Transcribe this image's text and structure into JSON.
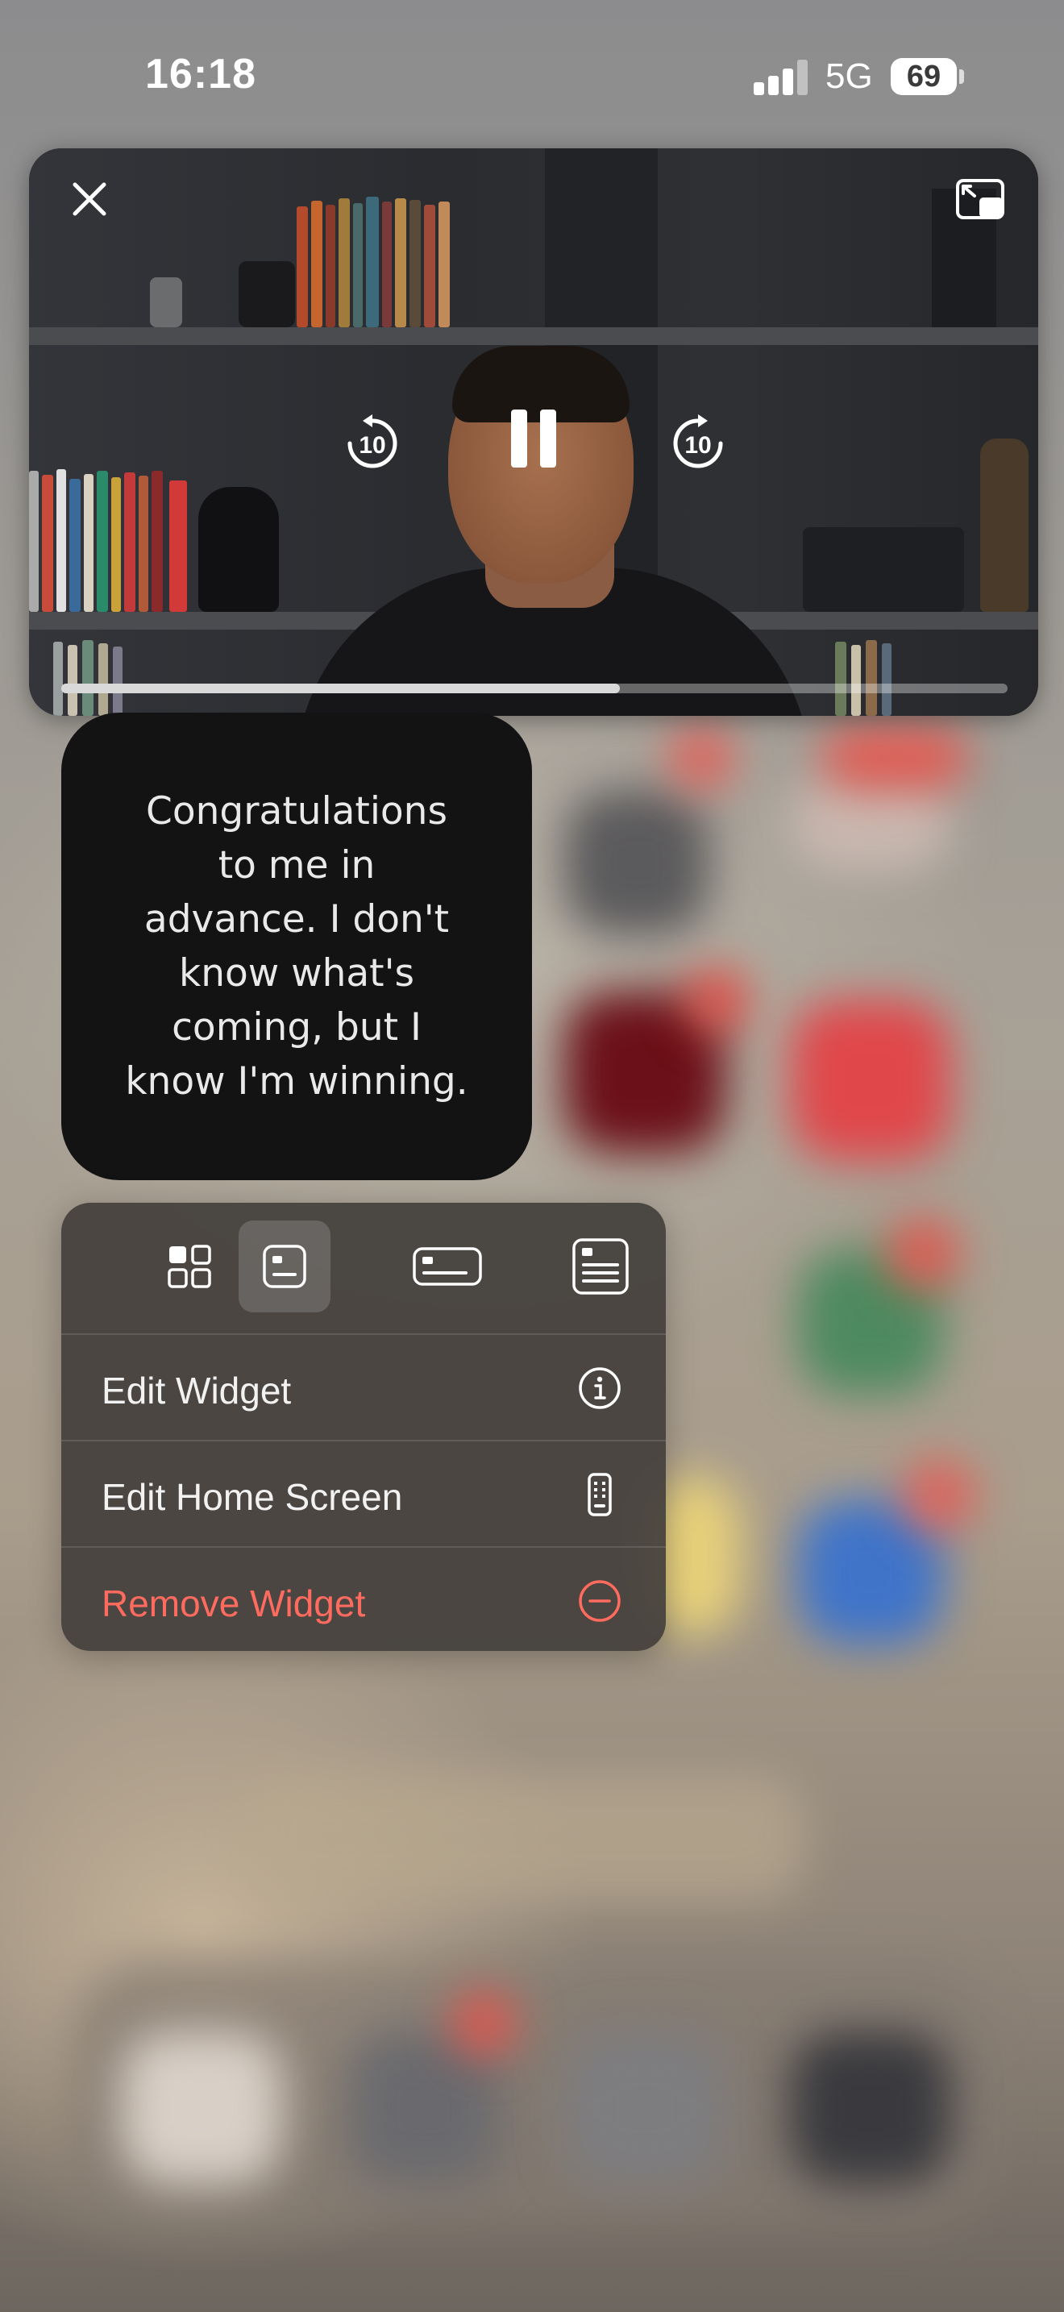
{
  "status_bar": {
    "time": "16:18",
    "network": "5G",
    "battery": "69"
  },
  "video": {
    "progress_fraction": 0.59,
    "controls": {
      "close_icon": "close-icon",
      "expand_icon": "pip-restore-icon",
      "skip_back_icon": "skip-back-10-icon",
      "skip_back_label": "10",
      "pause_icon": "pause-icon",
      "skip_forward_icon": "skip-forward-10-icon",
      "skip_forward_label": "10"
    }
  },
  "widget": {
    "quote": "Congratulations\nto me in\nadvance. I don't\nknow what's\ncoming, but I\nknow I'm winning."
  },
  "menu": {
    "sizes": [
      {
        "icon": "widget-grid-icon",
        "selected": false
      },
      {
        "icon": "widget-small-icon",
        "selected": true
      },
      {
        "icon": "widget-medium-icon",
        "selected": false
      },
      {
        "icon": "widget-large-icon",
        "selected": false
      }
    ],
    "items": [
      {
        "label": "Edit Widget",
        "icon": "info-icon"
      },
      {
        "label": "Edit Home Screen",
        "icon": "phone-icon"
      },
      {
        "label": "Remove Widget",
        "icon": "minus-circle-icon"
      }
    ]
  },
  "colors": {
    "destructive": "#ff6b5e",
    "menu_bg": "#44403c",
    "widget_bg": "#131313"
  }
}
